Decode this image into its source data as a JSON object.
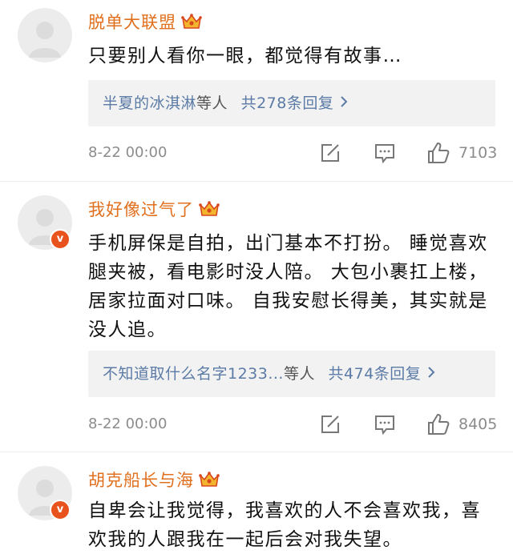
{
  "comments": [
    {
      "username": "脱单大联盟",
      "text": "只要别人看你一眼，都觉得有故事…",
      "reply_users": "半夏的冰淇淋",
      "reply_suffix": "等人",
      "reply_count": "共278条回复",
      "time": "8-22 00:00",
      "likes": "7103",
      "verified": false
    },
    {
      "username": "我好像过气了",
      "text": "手机屏保是自拍，出门基本不打扮。 睡觉喜欢腿夹被，看电影时没人陪。 大包小裹扛上楼，居家拉面对口味。 自我安慰长得美，其实就是没人追。",
      "reply_users": "不知道取什么名字1233...",
      "reply_suffix": "等人",
      "reply_count": "共474条回复",
      "time": "8-22 00:00",
      "likes": "8405",
      "verified": true,
      "verified_mark": "v"
    },
    {
      "username": "胡克船长与海",
      "text": "自卑会让我觉得，我喜欢的人不会喜欢我，喜欢我的人跟我在一起后会对我失望。",
      "verified": true,
      "verified_mark": "v"
    }
  ],
  "icons": {
    "crown": "crown-icon",
    "edit": "edit-icon",
    "comment": "comment-icon",
    "like": "thumbs-up-icon",
    "chevron": "chevron-right-icon"
  },
  "colors": {
    "username": "#e0701e",
    "reply_link": "#5b7ba6",
    "meta": "#8c8c8c",
    "badge": "#e8521d",
    "reply_bg": "#f2f2f2"
  }
}
